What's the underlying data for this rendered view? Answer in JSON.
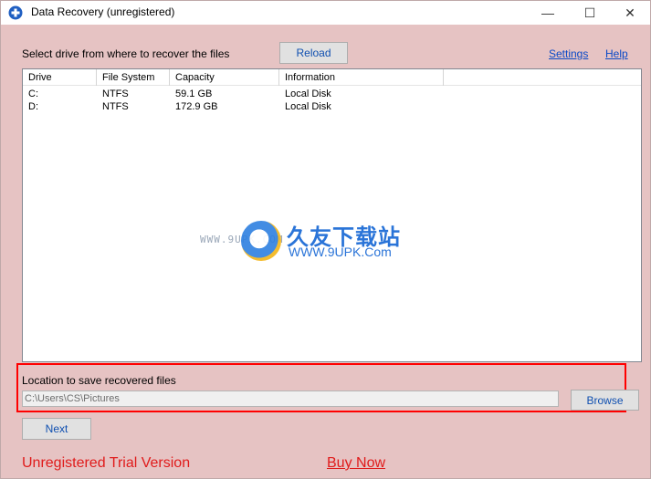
{
  "window": {
    "title": "Data Recovery (unregistered)",
    "controls": {
      "minimize": "—",
      "maximize": "☐",
      "close": "✕"
    }
  },
  "toolbar": {
    "select_label": "Select drive from where to recover the files",
    "reload_label": "Reload",
    "settings_label": "Settings",
    "help_label": "Help"
  },
  "drive_list": {
    "columns": [
      "Drive",
      "File System",
      "Capacity",
      "Information"
    ],
    "rows": [
      {
        "drive": "C:",
        "fs": "NTFS",
        "capacity": "59.1 GB",
        "info": "Local Disk"
      },
      {
        "drive": "D:",
        "fs": "NTFS",
        "capacity": "172.9 GB",
        "info": "Local Disk"
      }
    ]
  },
  "watermark": {
    "left_text": "WWW.9UPK.COM",
    "cn_text": "久友下载站",
    "url_text": "WWW.9UPK.Com"
  },
  "save_section": {
    "label": "Location to save recovered files",
    "path_value": "C:\\Users\\CS\\Pictures",
    "browse_label": "Browse"
  },
  "next_label": "Next",
  "footer": {
    "trial_text": "Unregistered Trial Version",
    "buy_label": "Buy Now"
  },
  "colors": {
    "window_bg": "#e6c3c3",
    "link": "#0a49c7",
    "trial_red": "#e01b1b",
    "highlight_box": "#ff0000"
  }
}
